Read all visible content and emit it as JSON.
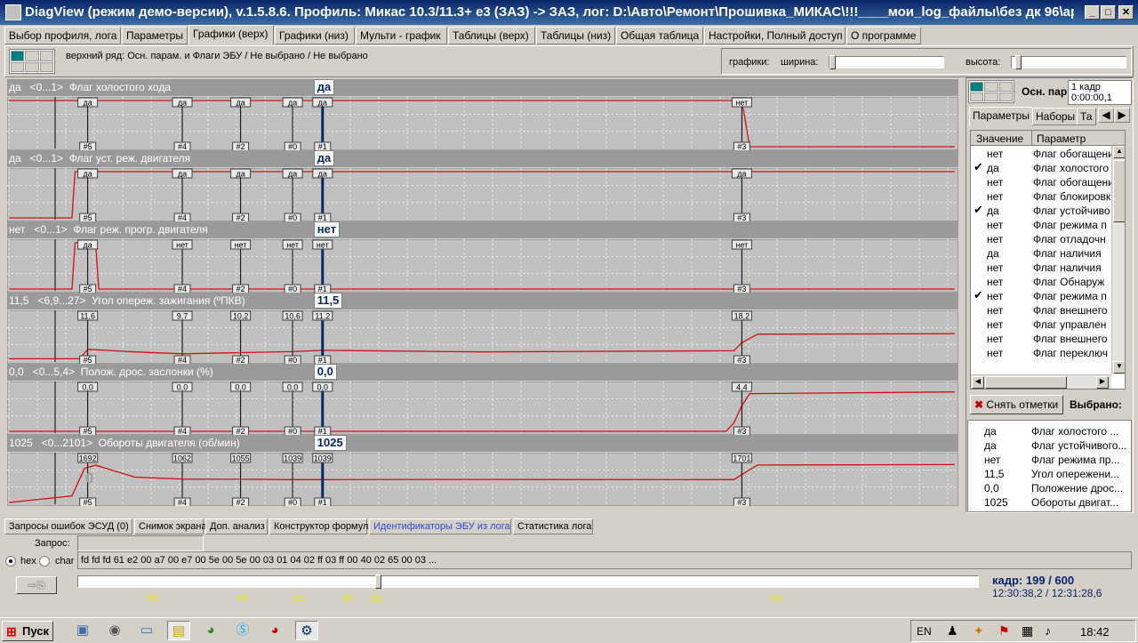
{
  "window": {
    "title": "DiagView (режим демо-версии), v.1.5.8.6. Профиль: Микас 10.3/11.3+ e3 (ЗАЗ) -> ЗАЗ,  лог: D:\\Авто\\Ремонт\\Прошивка_МИКАС\\!!!____мои_log_файлы\\без дк 96\\appLo...",
    "min_label": "_",
    "max_label": "□",
    "close_label": "✕"
  },
  "menu_tabs": [
    {
      "label": "Выбор профиля, лога",
      "active": false
    },
    {
      "label": "Параметры",
      "active": false
    },
    {
      "label": "Графики (верх)",
      "active": true
    },
    {
      "label": "Графики (низ)",
      "active": false
    },
    {
      "label": "Мульти - график",
      "active": false
    },
    {
      "label": "Таблицы (верх)",
      "active": false
    },
    {
      "label": "Таблицы (низ)",
      "active": false
    },
    {
      "label": "Общая таблица",
      "active": false
    },
    {
      "label": "Настройки, Полный доступ",
      "active": false
    },
    {
      "label": "О программе",
      "active": false
    }
  ],
  "toppanel": {
    "description": "верхний ряд: Осн. парам. и Флаги ЭБУ / Не выбрано / Не выбрано",
    "graphs_label": "графики:",
    "width_label": "ширина:",
    "height_label": "высота:"
  },
  "markers": [
    {
      "label": "#5",
      "frame": 50
    },
    {
      "label": "#4",
      "frame": 110
    },
    {
      "label": "#2",
      "frame": 147
    },
    {
      "label": "#0",
      "frame": 180
    },
    {
      "label": "#1",
      "frame": 199
    },
    {
      "label": "#3",
      "frame": 465
    }
  ],
  "charts": [
    {
      "header": "да   <0...1>  Флаг холостого хода",
      "current": "да",
      "marker_values": [
        "да",
        "да",
        "да",
        "да",
        "да",
        "нет"
      ]
    },
    {
      "header": "да   <0...1>  Флаг уст. реж. двигателя",
      "current": "да",
      "marker_values": [
        "да",
        "да",
        "да",
        "да",
        "да",
        "да"
      ]
    },
    {
      "header": "нет   <0...1>  Флаг реж. прогр. двигателя",
      "current": "нет",
      "marker_values": [
        "да",
        "нет",
        "нет",
        "нет",
        "нет",
        "нет"
      ]
    },
    {
      "header": "11,5   <6,9...27>  Угол опереж. зажигания (ºПКВ)",
      "current": "11,5",
      "marker_values": [
        "11,6",
        "9,7",
        "10,2",
        "10,6",
        "11,2",
        "18,2"
      ]
    },
    {
      "header": "0,0   <0...5,4>  Полож. дрос. заслонки (%)",
      "current": "0,0",
      "marker_values": [
        "0,0",
        "0,0",
        "0,0",
        "0,0",
        "0,0",
        "4,4"
      ]
    },
    {
      "header": "1025   <0...2101>  Обороты двигателя (об/мин)",
      "current": "1025",
      "marker_values": [
        "1692",
        "1062",
        "1055",
        "1039",
        "1039",
        "1701"
      ],
      "note": "0"
    }
  ],
  "chart_data": [
    {
      "type": "line",
      "title": "Флаг холостого хода",
      "x": [
        0,
        50,
        465,
        470,
        600
      ],
      "values": [
        1,
        1,
        1,
        0,
        0
      ],
      "ylim": [
        0,
        1
      ]
    },
    {
      "type": "line",
      "title": "Флаг уст. реж. двигателя",
      "x": [
        0,
        40,
        42,
        600
      ],
      "values": [
        0,
        0,
        1,
        1
      ],
      "ylim": [
        0,
        1
      ]
    },
    {
      "type": "line",
      "title": "Флаг реж. прогр. двигателя",
      "x": [
        0,
        40,
        42,
        55,
        57,
        600
      ],
      "values": [
        0,
        0,
        1,
        1,
        0,
        0
      ],
      "ylim": [
        0,
        1
      ]
    },
    {
      "type": "line",
      "title": "Угол опереж. зажигания (ºПКВ)",
      "x": [
        0,
        45,
        50,
        80,
        110,
        147,
        180,
        199,
        300,
        460,
        465,
        475,
        600
      ],
      "values": [
        7.5,
        7.5,
        11.6,
        10.5,
        9.7,
        10.2,
        10.6,
        11.2,
        10.5,
        11.0,
        14.5,
        18.2,
        18.4
      ],
      "ylim": [
        6.9,
        27
      ]
    },
    {
      "type": "line",
      "title": "Полож. дрос. заслонки (%)",
      "x": [
        0,
        455,
        460,
        465,
        470,
        600
      ],
      "values": [
        0,
        0,
        1.0,
        3.0,
        4.4,
        4.6
      ],
      "ylim": [
        0,
        5.4
      ]
    },
    {
      "type": "line",
      "title": "Обороты двигателя (об/мин)",
      "x": [
        0,
        40,
        48,
        55,
        80,
        110,
        147,
        180,
        199,
        300,
        460,
        468,
        475,
        600
      ],
      "values": [
        0,
        300,
        1550,
        1692,
        1150,
        1062,
        1055,
        1039,
        1039,
        1045,
        1040,
        1400,
        1701,
        1720
      ],
      "ylim": [
        0,
        2101
      ]
    }
  ],
  "right": {
    "header": "Осн. пар",
    "frame_info": "1 кадр\n0:00:00,1",
    "tabs": [
      "Параметры",
      "Наборы",
      "Та"
    ],
    "col_value": "Значение",
    "col_param": "Параметр",
    "rows": [
      {
        "check": false,
        "value": "нет",
        "name": "Флаг обогащения"
      },
      {
        "check": true,
        "value": "да",
        "name": "Флаг холостого"
      },
      {
        "check": false,
        "value": "нет",
        "name": "Флаг обогащения"
      },
      {
        "check": false,
        "value": "нет",
        "name": "Флаг блокировки"
      },
      {
        "check": true,
        "value": "да",
        "name": "Флаг устойчиво"
      },
      {
        "check": false,
        "value": "нет",
        "name": "Флаг режима п"
      },
      {
        "check": false,
        "value": "нет",
        "name": "Флаг отладочн"
      },
      {
        "check": false,
        "value": "да",
        "name": "Флаг наличия"
      },
      {
        "check": false,
        "value": "нет",
        "name": "Флаг наличия"
      },
      {
        "check": false,
        "value": "нет",
        "name": "Флаг Обнаруж"
      },
      {
        "check": true,
        "value": "нет",
        "name": "Флаг режима п"
      },
      {
        "check": false,
        "value": "нет",
        "name": "Флаг внешнего"
      },
      {
        "check": false,
        "value": "нет",
        "name": "Флаг управлен"
      },
      {
        "check": false,
        "value": "нет",
        "name": "Флаг внешнего"
      },
      {
        "check": false,
        "value": "нет",
        "name": "Флаг переключ"
      }
    ],
    "remove_marks": "Снять отметки",
    "selected": "Выбрано:",
    "selected_rows": [
      {
        "value": "да",
        "name": "Флаг холостого ..."
      },
      {
        "value": "да",
        "name": "Флаг устойчивого..."
      },
      {
        "value": "нет",
        "name": "Флаг режима пр..."
      },
      {
        "value": "11,5",
        "name": "Угол опережени..."
      },
      {
        "value": "0,0",
        "name": "Положение дрос..."
      },
      {
        "value": "1025",
        "name": "Обороты двигат..."
      }
    ]
  },
  "bottom_tabs": [
    "Запросы ошибок ЭСУД (0)",
    "Снимок экрана",
    "Доп. анализ",
    "Конструктор формул",
    "Идентификаторы ЭБУ из лога",
    "Статистика лога"
  ],
  "request_label": "Запрос:",
  "radio_hex": "hex",
  "radio_char": "char",
  "hex_data": "fd fd fd 61 e2 00 a7 00 e7 00 5e 00 5e 00 03 01 04 02 ff 03 ff 00 40 02 65 00 03 ...",
  "frame_status": "кадр: 199 / 600",
  "time_status": "12:30:38,2 / 12:31:28,6",
  "frame_position": 199,
  "frame_total": 600,
  "taskbar": {
    "start": "Пуск",
    "lang": "EN",
    "clock": "18:42"
  }
}
